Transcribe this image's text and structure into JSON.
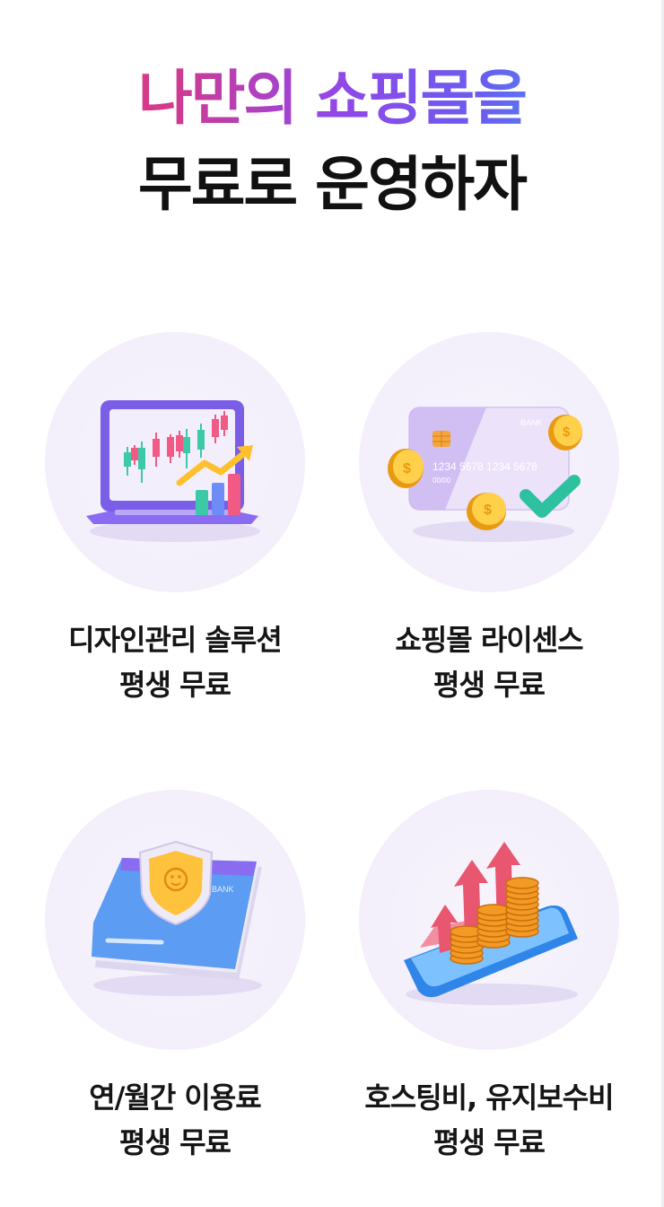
{
  "headline": {
    "line1": "나만의 쇼핑몰을",
    "line2": "무료로 운영하자"
  },
  "features": [
    {
      "title": "디자인관리 솔루션",
      "subtitle": "평생 무료",
      "icon": "laptop-chart-icon"
    },
    {
      "title": "쇼핑몰 라이센스",
      "subtitle": "평생 무료",
      "icon": "credit-card-icon",
      "card_text": {
        "brand": "BANK",
        "number": "1234 5678 1234 5678",
        "expiry": "00/00"
      }
    },
    {
      "title": "연/월간 이용료",
      "subtitle": "평생 무료",
      "icon": "bank-book-shield-icon",
      "book_text": "BANK"
    },
    {
      "title": "호스팅비, 유지보수비",
      "subtitle": "평생 무료",
      "icon": "phone-coins-arrows-icon"
    }
  ],
  "colors": {
    "gradient_start": "#ec3b6d",
    "gradient_mid": "#9347e6",
    "gradient_end": "#3aaef4",
    "circle_bg": "#f4f0fb",
    "text_dark": "#151515"
  }
}
